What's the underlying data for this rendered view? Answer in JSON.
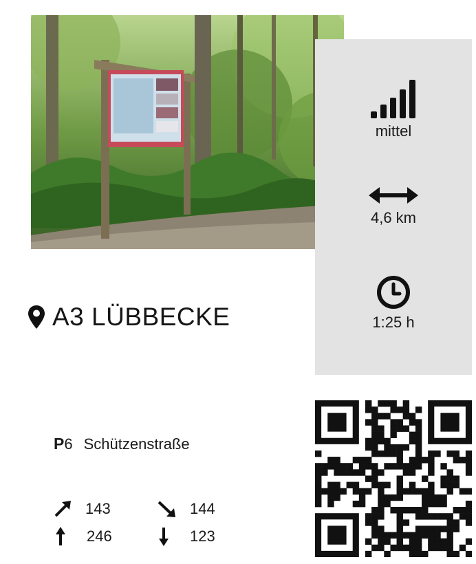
{
  "photo": {
    "alt_icon": "trail-information-board-in-forest"
  },
  "difficulty": {
    "icon": "signal-bars-icon",
    "label": "mittel"
  },
  "distance": {
    "icon": "double-arrow-icon",
    "label": "4,6 km"
  },
  "duration": {
    "icon": "clock-icon",
    "label": "1:25 h"
  },
  "route": {
    "icon": "map-pin-icon",
    "title": "A3 LÜBBECKE"
  },
  "parking": {
    "letter": "P",
    "number": "6",
    "street": "Schützenstraße"
  },
  "elevation": {
    "ascent_diag": "143",
    "descent_diag": "144",
    "max_height": "246",
    "min_height": "123"
  },
  "qr": {
    "icon": "qr-code"
  },
  "colors": {
    "panel": "#e3e3e3",
    "text": "#1a1a1a"
  }
}
